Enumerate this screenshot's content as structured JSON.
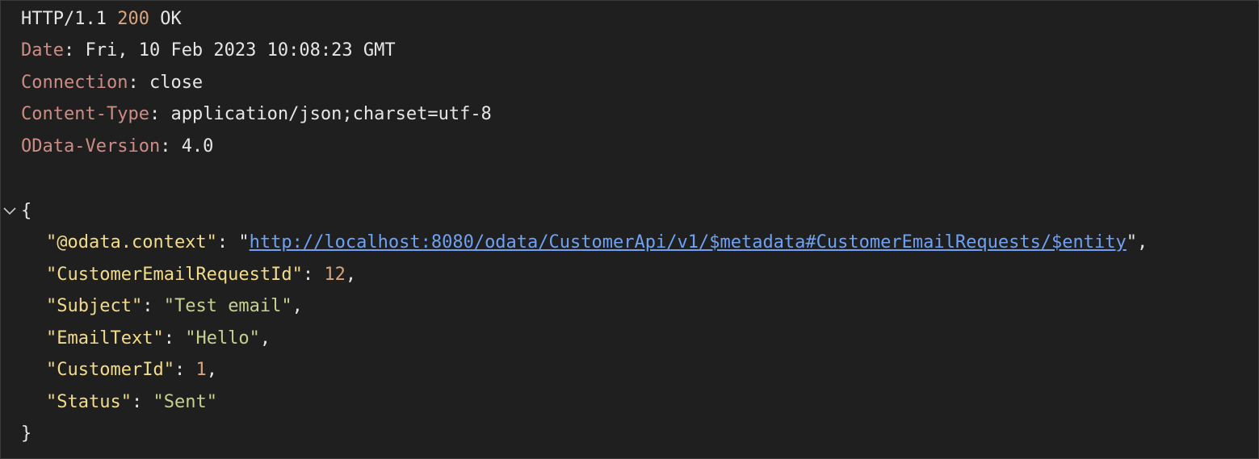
{
  "status_line": {
    "protocol": "HTTP/1.1",
    "code": "200",
    "text": "OK"
  },
  "headers": [
    {
      "name": "Date",
      "value": "Fri, 10 Feb 2023 10:08:23 GMT"
    },
    {
      "name": "Connection",
      "value": "close"
    },
    {
      "name": "Content-Type",
      "value": "application/json;charset=utf-8"
    },
    {
      "name": "OData-Version",
      "value": "4.0"
    }
  ],
  "body": {
    "open_brace": "{",
    "close_brace": "}",
    "fields": [
      {
        "key": "\"@odata.context\"",
        "value": "http://localhost:8080/odata/CustomerApi/v1/$metadata#CustomerEmailRequests/$entity",
        "type": "link"
      },
      {
        "key": "\"CustomerEmailRequestId\"",
        "value": "12",
        "type": "number"
      },
      {
        "key": "\"Subject\"",
        "value": "\"Test email\"",
        "type": "string"
      },
      {
        "key": "\"EmailText\"",
        "value": "\"Hello\"",
        "type": "string"
      },
      {
        "key": "\"CustomerId\"",
        "value": "1",
        "type": "number"
      },
      {
        "key": "\"Status\"",
        "value": "\"Sent\"",
        "type": "string"
      }
    ]
  },
  "colors": {
    "background": "#1f1f1f",
    "header_name": "#cd8c85",
    "number": "#d9a57e",
    "json_key": "#f2dc8a",
    "json_string": "#c7d18e",
    "link": "#6fa2f5",
    "text": "#e6e6e6"
  },
  "icons": {
    "fold": "chevron-down-icon"
  }
}
